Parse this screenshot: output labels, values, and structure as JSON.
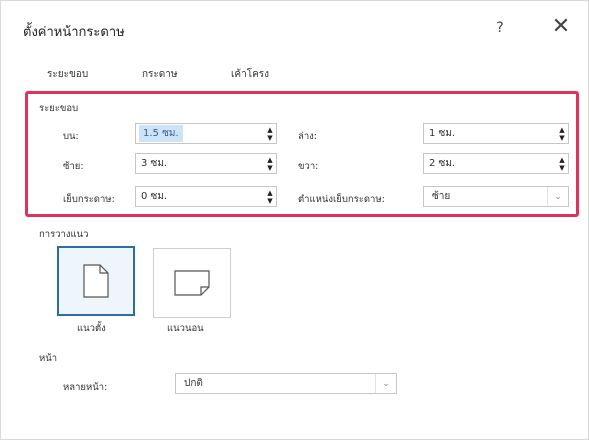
{
  "dialog": {
    "title": "ตั้งค่าหน้ากระดาษ",
    "help_label": "?",
    "close_label": "✕"
  },
  "tabs": [
    {
      "label": "ระยะขอบ"
    },
    {
      "label": "กระดาษ"
    },
    {
      "label": "เค้าโครง"
    }
  ],
  "margins": {
    "group_label": "ระยะขอบ",
    "top": {
      "label": "บน:",
      "value": "1.5 ซม."
    },
    "bottom": {
      "label": "ล่าง:",
      "value": "1 ซม."
    },
    "left": {
      "label": "ซ้าย:",
      "value": "3 ซม."
    },
    "right": {
      "label": "ขวา:",
      "value": "2 ซม."
    },
    "gutter": {
      "label": "เย็บกระดาษ:",
      "value": "0 ซม."
    },
    "gutter_position": {
      "label": "ตำแหน่งเย็บกระดาษ:",
      "value": "ซ้าย"
    }
  },
  "orientation": {
    "group_label": "การวางแนว",
    "portrait_label": "แนวตั้ง",
    "landscape_label": "แนวนอน",
    "selected": "portrait"
  },
  "pages": {
    "group_label": "หน้า",
    "multiple_label": "หลายหน้า:",
    "multiple_value": "ปกติ"
  },
  "colors": {
    "highlight_border": "#e0335a",
    "selected_orientation": "#2b6ea8",
    "selected_text_bg": "#cde3f7"
  },
  "icons": {
    "spinner": "spin-up-down-arrows",
    "dropdown": "chevron-down-icon",
    "close": "close-icon",
    "help": "help-icon"
  }
}
